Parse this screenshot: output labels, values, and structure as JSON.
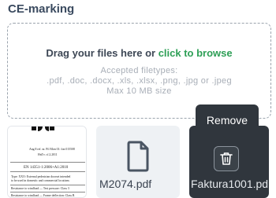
{
  "section": {
    "title": "CE-marking"
  },
  "dropzone": {
    "prompt": "Drag your files here or ",
    "link": "click to browse",
    "accepted_label": "Accepted filetypes:",
    "filetypes": ".pdf, .doc, .docx, .xls, .xlsx, .png, .jpg or .jpeg",
    "max_size": "Max 10 MB size"
  },
  "files": [
    {
      "type": "image",
      "preview_lines": [
        "Ang.8 ref. nr. Pil Mon 01: fon 015508",
        "HnTv. cf.2.2011",
        "EN 14351-1:2006+A1:2010",
        "Type: XXO: External pedestrian doorset intended",
        "to be used in domestic and commercial locations",
        "Resistance to windload — Test pressure: Class 3",
        "Resistance to windload — Frame deflection: Class B"
      ]
    },
    {
      "type": "document",
      "name": "M2074.pdf",
      "icon": "file-icon"
    },
    {
      "type": "document",
      "name": "Faktura1001.pd",
      "icon": "trash-icon"
    }
  ],
  "tooltip": {
    "text": "Remove"
  },
  "colors": {
    "link": "#2e9f56",
    "tooltip_bg": "#30363d",
    "title": "#3a4a5f"
  }
}
